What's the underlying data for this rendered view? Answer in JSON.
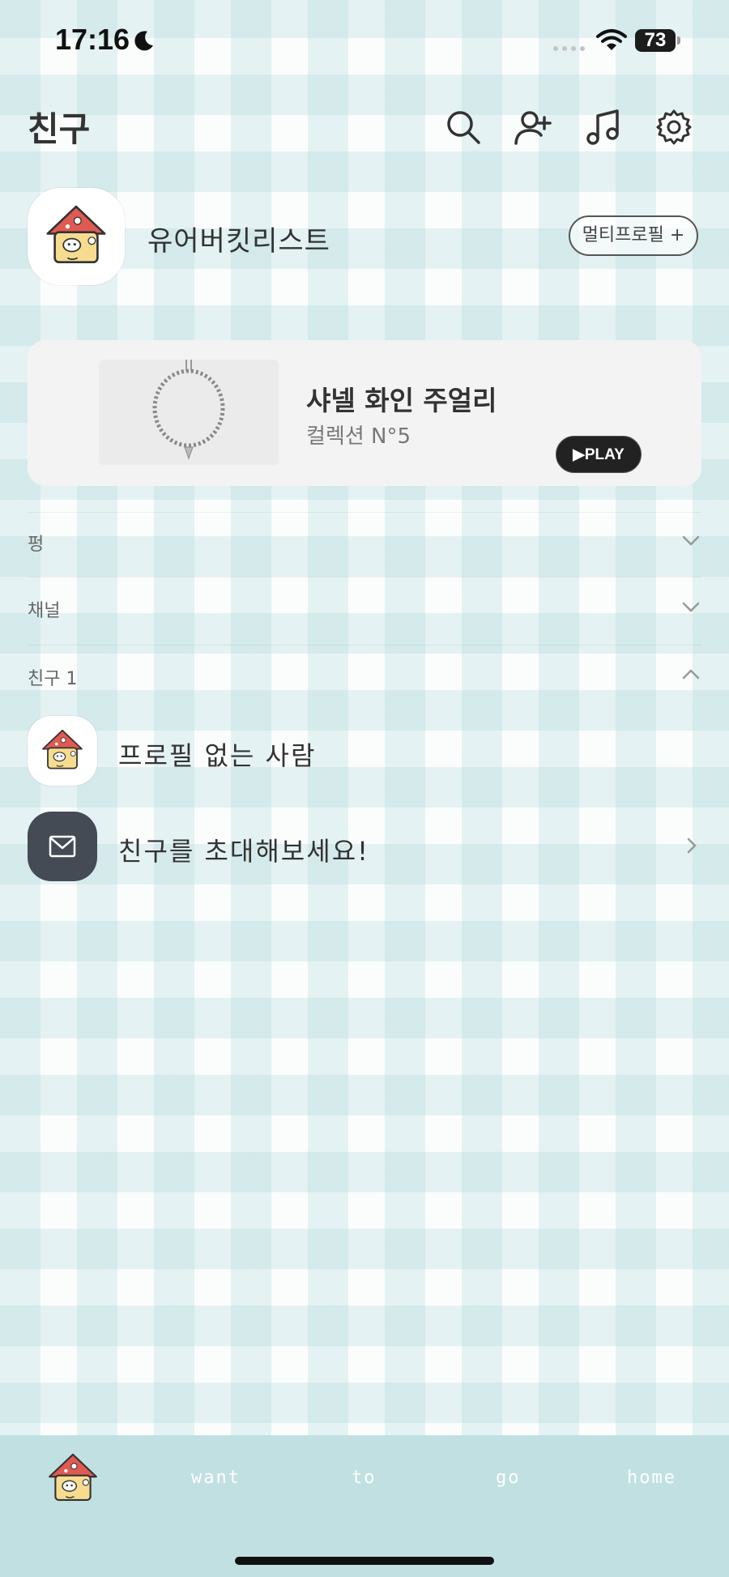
{
  "status_bar": {
    "time": "17:16",
    "battery": "73"
  },
  "header": {
    "title": "친구"
  },
  "my_profile": {
    "name": "유어버킷리스트",
    "multi_profile_label": "멀티프로필 +"
  },
  "music": {
    "title": "샤넬 화인 주얼리",
    "subtitle": "컬렉션 N°5",
    "play_label": "▶PLAY"
  },
  "sections": {
    "pung": "펑",
    "channel": "채널",
    "friends": "친구 1"
  },
  "friends": [
    {
      "name": "프로필 없는 사람"
    }
  ],
  "invite": {
    "label": "친구를 초대해보세요!"
  },
  "tab_bar": {
    "labels": [
      "want",
      "to",
      "go",
      "home"
    ]
  },
  "colors": {
    "tab_bar_bg": "#c1e0e2",
    "invite_icon_bg": "#454b55",
    "house_roof": "#e05a52",
    "house_body": "#f7dc8f"
  }
}
